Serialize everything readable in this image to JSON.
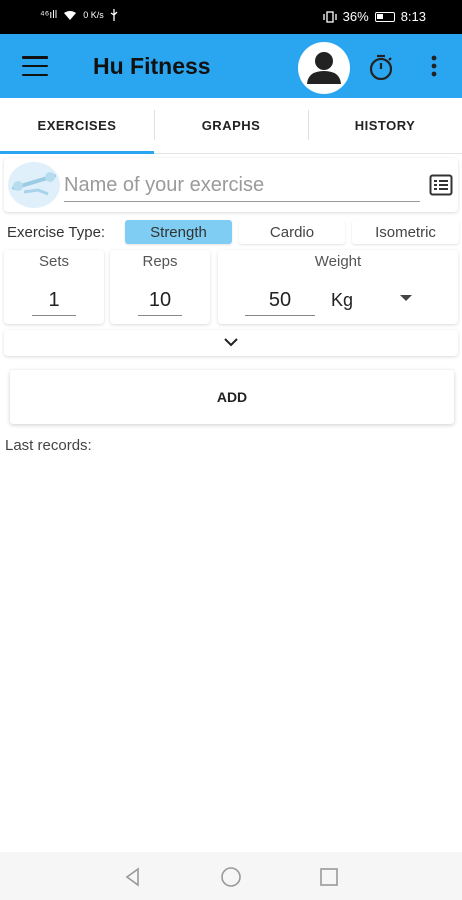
{
  "status_bar": {
    "left": "⁴⁶ıll",
    "net_speed": "0 K/s",
    "battery": "36%",
    "time": "8:13"
  },
  "app_bar": {
    "title": "Hu Fitness",
    "icons": [
      "menu-icon",
      "account-icon",
      "timer-icon",
      "more-vert-icon"
    ]
  },
  "tabs": [
    {
      "label": "EXERCISES",
      "active": true
    },
    {
      "label": "GRAPHS",
      "active": false
    },
    {
      "label": "HISTORY",
      "active": false
    }
  ],
  "exercise": {
    "name_placeholder": "Name of your exercise",
    "name_value": ""
  },
  "exercise_type": {
    "label": "Exercise Type:",
    "options": [
      "Strength",
      "Cardio",
      "Isometric"
    ],
    "selected": "Strength"
  },
  "fields": {
    "sets": {
      "label": "Sets",
      "value": "1"
    },
    "reps": {
      "label": "Reps",
      "value": "10"
    },
    "weight": {
      "label": "Weight",
      "value": "50",
      "unit": "Kg"
    }
  },
  "actions": {
    "add_label": "ADD"
  },
  "records": {
    "label": "Last records:"
  },
  "colors": {
    "primary": "#2aa6f1",
    "selected_type": "#7fcdf2"
  }
}
